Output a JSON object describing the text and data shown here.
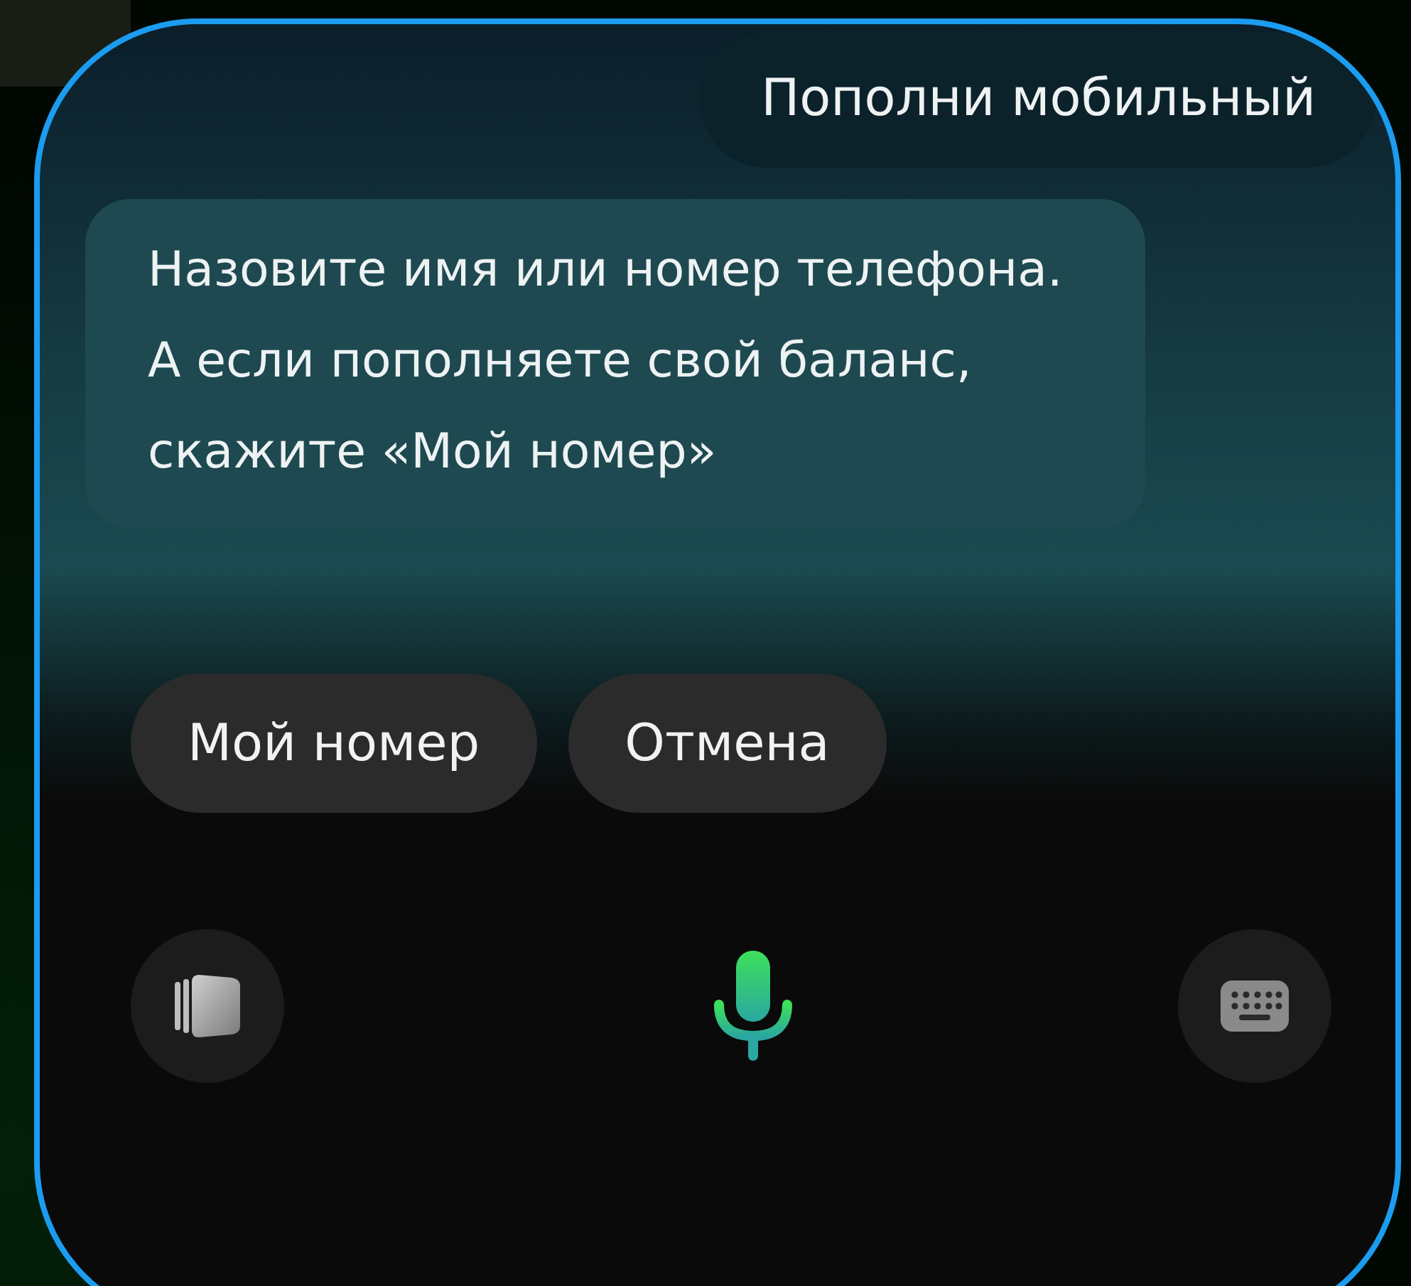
{
  "messages": [
    {
      "kind": "user",
      "text": "Пополни мобильный"
    },
    {
      "kind": "assistant",
      "text": "Назовите имя или номер телефона. А если пополняете свой баланс, скажите «Мой номер»"
    }
  ],
  "suggestions": [
    "Мой номер",
    "Отмена"
  ]
}
